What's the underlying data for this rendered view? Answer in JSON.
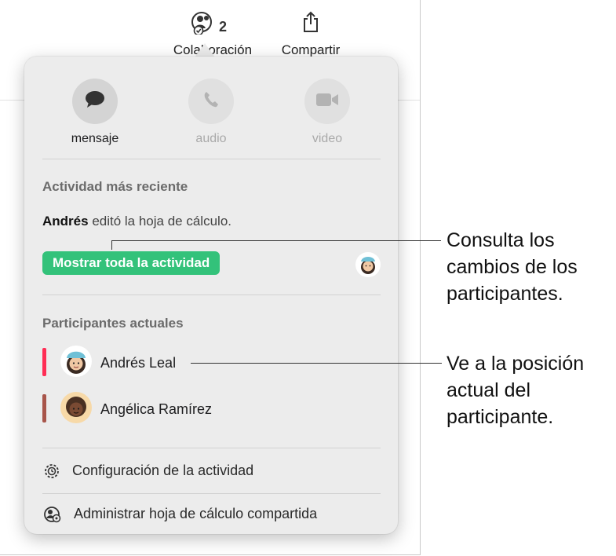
{
  "toolbar": {
    "collaboration": {
      "label": "Colaboración",
      "count": "2",
      "icon": "collaboration-icon"
    },
    "share": {
      "label": "Compartir",
      "icon": "share-icon"
    }
  },
  "popover": {
    "communication": [
      {
        "label": "mensaje",
        "icon": "message-bubble-icon",
        "enabled": true
      },
      {
        "label": "audio",
        "icon": "phone-icon",
        "enabled": false
      },
      {
        "label": "video",
        "icon": "video-camera-icon",
        "enabled": false
      }
    ],
    "recent_activity": {
      "title": "Actividad más reciente",
      "actor": "Andrés",
      "action": "editó la hoja de cálculo.",
      "show_all_label": "Mostrar toda la actividad"
    },
    "participants": {
      "title": "Participantes actuales",
      "items": [
        {
          "name": "Andrés Leal",
          "color": "#ff2d55"
        },
        {
          "name": "Angélica Ramírez",
          "color": "#a8554a"
        }
      ]
    },
    "menu": {
      "activity_settings": "Configuración de la actividad",
      "manage_shared": "Administrar hoja de cálculo compartida"
    }
  },
  "callouts": [
    "Consulta los cambios de los participantes.",
    "Ve a la posición actual del participante."
  ],
  "colors": {
    "accent_green": "#33c27a",
    "popover_bg": "#ececec"
  }
}
